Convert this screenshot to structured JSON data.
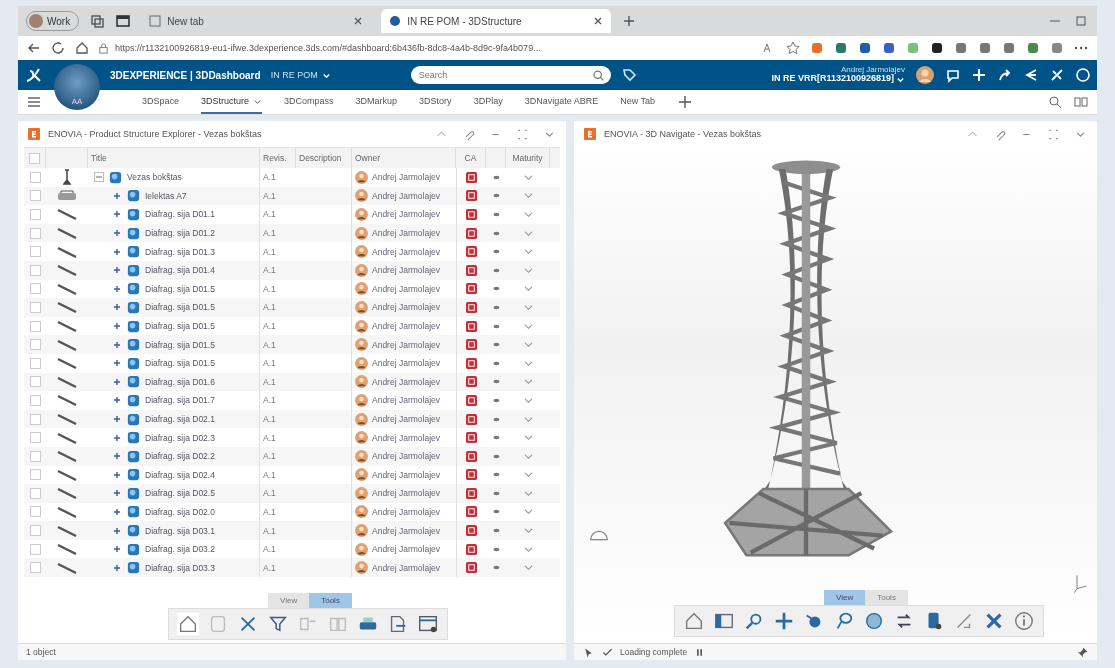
{
  "browser": {
    "profile": "Work",
    "tabs": [
      {
        "title": "New tab",
        "selected": false
      },
      {
        "title": "IN RE POM - 3DStructure",
        "selected": true
      }
    ],
    "url": "https://r1132100926819-eu1-ifwe.3dexperience.3ds.com/#dashboard:6b436fb-8dc8-4a4b-8d9c-9fa4b079..."
  },
  "app_header": {
    "brand": "3DEXPERIENCE | 3DDashboard",
    "dashboard": "IN RE POM",
    "compass_label": "AA",
    "search": {
      "placeholder": "Search"
    },
    "user_name": "Andrej Jarmolajev",
    "tenant": "IN RE VRR[R1132100926819]"
  },
  "dashboard_tabs": [
    {
      "label": "3DSpace",
      "selected": false,
      "has_menu": false
    },
    {
      "label": "3DStructure",
      "selected": true,
      "has_menu": true
    },
    {
      "label": "3DCompass",
      "selected": false,
      "has_menu": false
    },
    {
      "label": "3DMarkup",
      "selected": false,
      "has_menu": false
    },
    {
      "label": "3DStory",
      "selected": false,
      "has_menu": false
    },
    {
      "label": "3DPlay",
      "selected": false,
      "has_menu": false
    },
    {
      "label": "3DNavigate ABRE",
      "selected": false,
      "has_menu": false
    },
    {
      "label": "New Tab",
      "selected": false,
      "has_menu": false
    }
  ],
  "structure_panel": {
    "title": "ENOVIA - Product Structure Explorer - Vezas bokštas",
    "columns": [
      "Title",
      "Revis.",
      "Description",
      "Owner",
      "CA",
      "",
      "Maturity"
    ],
    "rows": [
      {
        "title": "Vezas bokštas",
        "revision": "A.1",
        "owner": "Andrej Jarmolajev",
        "kind": "tower",
        "checked": false,
        "expanded": true,
        "children": [
          {
            "title": "Ielektas A7",
            "revision": "A.1",
            "owner": "Andrej Jarmolajev",
            "kind": "assembly",
            "checked": false,
            "expanded": false
          },
          {
            "title": "Diafrag. sija D01.1",
            "revision": "A.1",
            "owner": "Andrej Jarmolajev",
            "kind": "rod",
            "checked": false,
            "expanded": false
          },
          {
            "title": "Diafrag. sija D01.2",
            "revision": "A.1",
            "owner": "Andrej Jarmolajev",
            "kind": "rod",
            "checked": false,
            "expanded": false
          },
          {
            "title": "Diafrag. sija D01.3",
            "revision": "A.1",
            "owner": "Andrej Jarmolajev",
            "kind": "rod",
            "checked": false,
            "expanded": false
          },
          {
            "title": "Diafrag. sija D01.4",
            "revision": "A.1",
            "owner": "Andrej Jarmolajev",
            "kind": "rod",
            "checked": false,
            "expanded": false
          },
          {
            "title": "Diafrag. sija D01.5",
            "revision": "A.1",
            "owner": "Andrej Jarmolajev",
            "kind": "rod",
            "checked": false,
            "expanded": false
          },
          {
            "title": "Diafrag. sija D01.5",
            "revision": "A.1",
            "owner": "Andrej Jarmolajev",
            "kind": "rod",
            "checked": false,
            "expanded": false
          },
          {
            "title": "Diafrag. sija D01.5",
            "revision": "A.1",
            "owner": "Andrej Jarmolajev",
            "kind": "rod",
            "checked": false,
            "expanded": false
          },
          {
            "title": "Diafrag. sija D01.5",
            "revision": "A.1",
            "owner": "Andrej Jarmolajev",
            "kind": "rod",
            "checked": false,
            "expanded": false
          },
          {
            "title": "Diafrag. sija D01.5",
            "revision": "A.1",
            "owner": "Andrej Jarmolajev",
            "kind": "rod",
            "checked": false,
            "expanded": false
          },
          {
            "title": "Diafrag. sija D01.6",
            "revision": "A.1",
            "owner": "Andrej Jarmolajev",
            "kind": "rod",
            "checked": false,
            "expanded": false
          },
          {
            "title": "Diafrag. sija D01.7",
            "revision": "A.1",
            "owner": "Andrej Jarmolajev",
            "kind": "rod",
            "checked": false,
            "expanded": false
          },
          {
            "title": "Diafrag. sija D02.1",
            "revision": "A.1",
            "owner": "Andrej Jarmolajev",
            "kind": "rod",
            "checked": false,
            "expanded": false
          },
          {
            "title": "Diafrag. sija D02.3",
            "revision": "A.1",
            "owner": "Andrej Jarmolajev",
            "kind": "rod",
            "checked": false,
            "expanded": false
          },
          {
            "title": "Diafrag. sija D02.2",
            "revision": "A.1",
            "owner": "Andrej Jarmolajev",
            "kind": "rod",
            "checked": false,
            "expanded": false
          },
          {
            "title": "Diafrag. sija D02.4",
            "revision": "A.1",
            "owner": "Andrej Jarmolajev",
            "kind": "rod",
            "checked": false,
            "expanded": false
          },
          {
            "title": "Diafrag. sija D02.5",
            "revision": "A.1",
            "owner": "Andrej Jarmolajev",
            "kind": "rod",
            "checked": false,
            "expanded": false
          },
          {
            "title": "Diafrag. sija D02.0",
            "revision": "A.1",
            "owner": "Andrej Jarmolajev",
            "kind": "rod",
            "checked": false,
            "expanded": false
          },
          {
            "title": "Diafrag. sija D03.1",
            "revision": "A.1",
            "owner": "Andrej Jarmolajev",
            "kind": "rod",
            "checked": false,
            "expanded": false
          },
          {
            "title": "Diafrag. sija D03.2",
            "revision": "A.1",
            "owner": "Andrej Jarmolajev",
            "kind": "rod",
            "checked": false,
            "expanded": false
          },
          {
            "title": "Diafrag. sija D03.3",
            "revision": "A.1",
            "owner": "Andrej Jarmolajev",
            "kind": "rod",
            "checked": false,
            "expanded": false
          }
        ]
      }
    ],
    "all_checked": false,
    "toolbar_tabs": [
      {
        "label": "View",
        "selected": false
      },
      {
        "label": "Tools",
        "selected": true
      }
    ],
    "status": "1 object"
  },
  "navigate_panel": {
    "title": "ENOVIA - 3D Navigate - Vezas bokštas",
    "toolbar_tabs": [
      {
        "label": "View",
        "selected": true
      },
      {
        "label": "Tools",
        "selected": false
      }
    ],
    "status": "Loading complete"
  }
}
